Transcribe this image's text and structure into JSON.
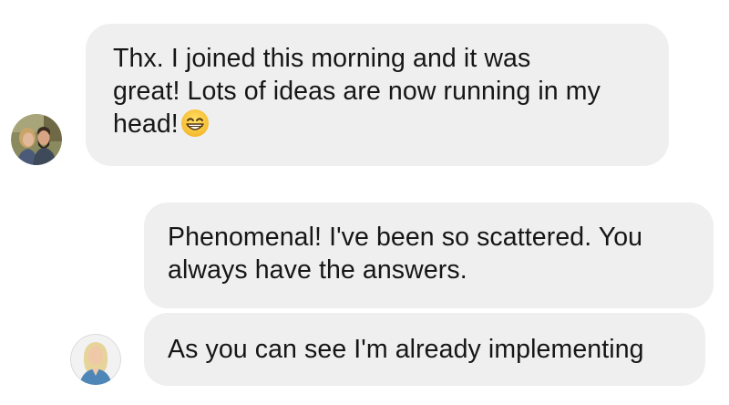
{
  "conversation": {
    "messages": [
      {
        "sender": "other",
        "text": "Thx. I joined this morning and it was\ngreat! Lots of ideas are now running in my\nhead!",
        "emoji": "grinning-face-with-smiling-eyes"
      },
      {
        "sender": "me",
        "text": "Phenomenal! I've been so scattered. You\nalways have the answers."
      },
      {
        "sender": "me",
        "text": "As you can see I'm already implementing"
      }
    ]
  },
  "colors": {
    "bubble_background": "#efeff0",
    "text": "#161616",
    "page_background": "#ffffff"
  },
  "icons": {
    "avatar_1": "couple-profile-photo",
    "avatar_2": "blonde-woman-profile-photo",
    "emoji": "grinning-face-with-smiling-eyes-emoji"
  }
}
